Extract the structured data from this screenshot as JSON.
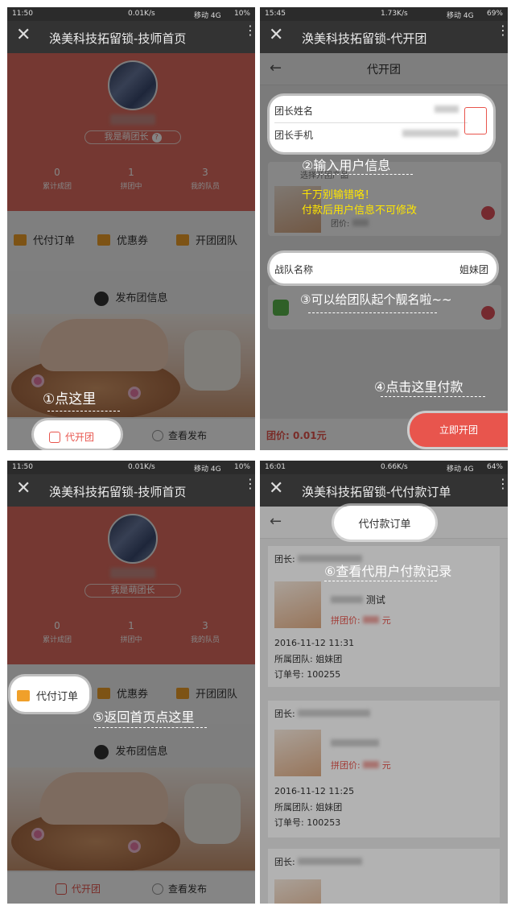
{
  "status1": {
    "time": "11:50",
    "net": "0.01K/s",
    "carrier": "移动 4G",
    "battery": "10%"
  },
  "status2": {
    "time": "15:45",
    "net": "1.73K/s",
    "carrier": "移动 4G",
    "battery": "69%"
  },
  "status3": {
    "time": "11:50",
    "net": "0.01K/s",
    "carrier": "移动 4G",
    "battery": "10%"
  },
  "status4": {
    "time": "16:01",
    "net": "0.66K/s",
    "carrier": "移动 4G",
    "battery": "64%"
  },
  "titles": {
    "home": "涣美科技拓留锁-技师首页",
    "group": "涣美科技拓留锁-代开团",
    "orders": "涣美科技拓留锁-代付款订单"
  },
  "home": {
    "role": "我是萌团长",
    "help": "?",
    "stats": [
      {
        "value": "0",
        "label": "累计成团"
      },
      {
        "value": "1",
        "label": "拼团中"
      },
      {
        "value": "3",
        "label": "我的队员"
      }
    ],
    "menu": {
      "pay": "代付订单",
      "coupon": "优惠券",
      "team": "开团团队"
    },
    "publish": "发布团信息",
    "tabs": {
      "group": "代开团",
      "view": "查看发布"
    }
  },
  "hints": {
    "h1": "①点这里",
    "h2": "②输入用户信息",
    "warn1": "千万别输错咯！",
    "warn2": "付款后用户信息不可修改",
    "h3": "③可以给团队起个靓名啦~~",
    "h4": "④点击这里付款",
    "h5": "⑤返回首页点这里",
    "h6": "⑥查看代用户付款记录"
  },
  "group": {
    "page_title": "代开团",
    "leader_name_label": "团长姓名",
    "leader_phone_label": "团长手机",
    "select_title": "选择开团产品",
    "price_label": "团价:",
    "team_name_label": "战队名称",
    "team_name_value": "姐妹团",
    "total_label": "团价:",
    "total_value": "0.01元",
    "submit": "立即开团"
  },
  "orders": {
    "page_title": "代付款订单",
    "leader_label": "团长:",
    "group_price_label": "拼团价:",
    "yuan": "元",
    "team_label": "所属团队:",
    "order_label": "订单号:",
    "items": [
      {
        "product": "测试",
        "time": "2016-11-12 11:31",
        "team": "姐妹团",
        "order_no": "100255"
      },
      {
        "time": "2016-11-12 11:25",
        "team": "姐妹团",
        "order_no": "100253"
      }
    ]
  },
  "colors": {
    "brand": "#e06c60",
    "accent": "#e8554d",
    "warn": "#ffe600"
  }
}
